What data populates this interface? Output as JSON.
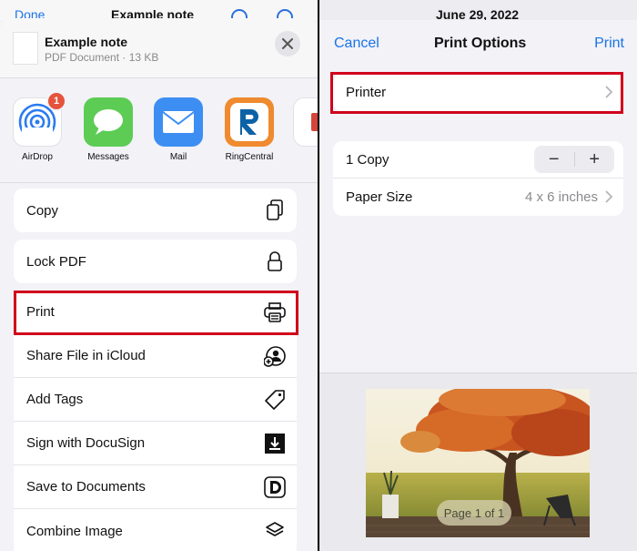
{
  "left": {
    "background_nav": {
      "back": "Done",
      "title": "Example note"
    },
    "doc": {
      "title": "Example note",
      "subtitle": "PDF Document · 13 KB"
    },
    "apps": [
      {
        "label": "AirDrop",
        "icon": "airdrop-icon",
        "badge": "1"
      },
      {
        "label": "Messages",
        "icon": "messages-icon"
      },
      {
        "label": "Mail",
        "icon": "mail-icon"
      },
      {
        "label": "RingCentral",
        "icon": "ringcentral-icon"
      }
    ],
    "actions_top": [
      {
        "label": "Copy",
        "icon": "copy-icon"
      }
    ],
    "actions_lock": [
      {
        "label": "Lock PDF",
        "icon": "lock-icon"
      }
    ],
    "actions_list": [
      {
        "label": "Print",
        "icon": "printer-icon"
      },
      {
        "label": "Share File in iCloud",
        "icon": "person-add-icon"
      },
      {
        "label": "Add Tags",
        "icon": "tag-icon"
      },
      {
        "label": "Sign with DocuSign",
        "icon": "download-icon"
      },
      {
        "label": "Save to Documents",
        "icon": "documents-icon"
      },
      {
        "label": "Combine Image",
        "icon": "layers-icon"
      }
    ],
    "highlight_color": "#d0021b"
  },
  "right": {
    "status": {
      "date": "June 29, 2022"
    },
    "nav": {
      "cancel": "Cancel",
      "title": "Print Options",
      "print": "Print"
    },
    "printer_row": {
      "label": "Printer"
    },
    "copies": {
      "label": "1 Copy",
      "minus": "−",
      "plus": "+"
    },
    "paper": {
      "label": "Paper Size",
      "value": "4 x 6 inches"
    },
    "preview": {
      "page_label": "Page 1 of 1"
    }
  },
  "colors": {
    "accent": "#1a73e8",
    "highlight": "#d0021b",
    "sheet_bg": "#f2f2f7"
  }
}
